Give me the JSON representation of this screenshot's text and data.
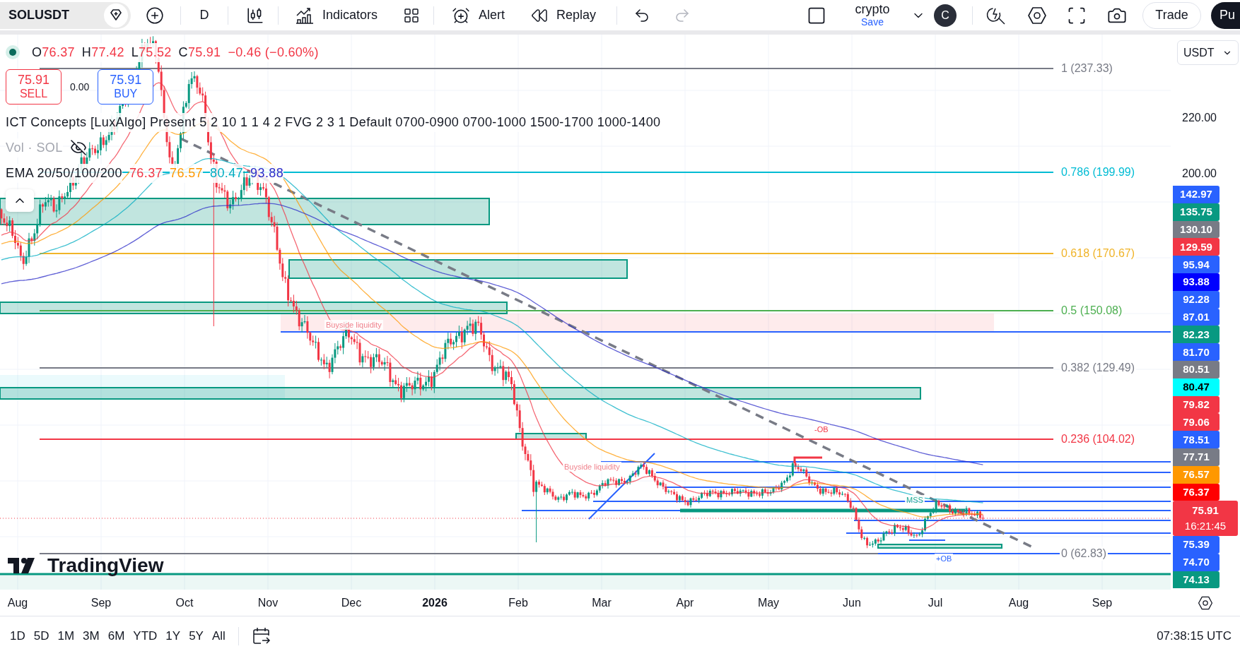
{
  "toolbar": {
    "symbol": "SOLUSDT",
    "interval": "D",
    "buttons": [
      {
        "kind": "indicators",
        "label": "Indicators"
      },
      {
        "kind": "alert",
        "label": "Alert"
      },
      {
        "kind": "replay",
        "label": "Replay"
      }
    ],
    "undo": {
      "disabled": false
    },
    "redo": {
      "disabled": true
    },
    "layout": {
      "name": "crypto",
      "status": "Save"
    },
    "avatar": "C",
    "trade_button": "Trade",
    "publish_button": "Pu"
  },
  "legend": {
    "ohlc": [
      {
        "key": "O",
        "value": "76.37"
      },
      {
        "key": "H",
        "value": "77.42"
      },
      {
        "key": "L",
        "value": "75.52"
      },
      {
        "key": "C",
        "value": "75.91"
      }
    ],
    "change": "−0.46 (−0.60%)"
  },
  "order_buttons": [
    {
      "kind": "sell",
      "price": "75.91",
      "label": "SELL"
    },
    {
      "kind": "buy",
      "price": "75.91",
      "label": "BUY"
    }
  ],
  "spread": "0.00",
  "studies": [
    {
      "title": "ICT Concepts [LuxAlgo] Present 5 2 10 1 1 4 2 FVG 2 3 1 Default 0700-0900 0700-1000 1500-1700 1000-1400",
      "hidden": false
    },
    {
      "title": "Vol · SOL",
      "hidden": true
    },
    {
      "title": "EMA 20/50/100/200",
      "hidden": false,
      "values": [
        {
          "value": "76.37",
          "color": "#f23645"
        },
        {
          "value": "76.57",
          "color": "#ff9800"
        },
        {
          "value": "80.47",
          "color": "#00acc1"
        },
        {
          "value": "93.88",
          "color": "#2c2cc8"
        }
      ]
    }
  ],
  "fib_levels": [
    {
      "label": "1 (237.33)",
      "color": "#787b86"
    },
    {
      "label": "0.786 (199.99)",
      "color": "#00bcd4"
    },
    {
      "label": "0.618 (170.67)",
      "color": "#f0b429"
    },
    {
      "label": "0.5 (150.08)",
      "color": "#4caf50"
    },
    {
      "label": "0.382 (129.49)",
      "color": "#787b86"
    },
    {
      "label": "0.236 (104.02)",
      "color": "#f23645"
    },
    {
      "label": "0 (62.83)",
      "color": "#787b86"
    }
  ],
  "chart_labels": [
    {
      "text": "Buyside liquidity",
      "color": "#f0848e"
    },
    {
      "text": "Buyside liquidity",
      "color": "#f0848e"
    },
    {
      "text": "-OB",
      "color": "#f23645"
    },
    {
      "text": "MSS",
      "color": "#22ab94"
    },
    {
      "text": "+OB",
      "color": "#2962ff"
    }
  ],
  "branding": {
    "logo_text": "TradingView"
  },
  "price_scale": {
    "currency": "USDT",
    "ticks": [
      "220.00",
      "200.00"
    ],
    "tags": [
      {
        "kind": "level",
        "value": "142.97",
        "color": "#2962ff"
      },
      {
        "kind": "level",
        "value": "135.75",
        "color": "#089981"
      },
      {
        "kind": "level",
        "value": "130.10",
        "color": "#787b86"
      },
      {
        "kind": "level",
        "value": "129.59",
        "color": "#f23645"
      },
      {
        "kind": "level",
        "value": "95.94",
        "color": "#2962ff"
      },
      {
        "kind": "level",
        "value": "93.88",
        "color": "#0000ff"
      },
      {
        "kind": "level",
        "value": "92.28",
        "color": "#2962ff"
      },
      {
        "kind": "level",
        "value": "87.01",
        "color": "#2962ff"
      },
      {
        "kind": "level",
        "value": "82.23",
        "color": "#089981"
      },
      {
        "kind": "level",
        "value": "81.70",
        "color": "#2962ff"
      },
      {
        "kind": "level",
        "value": "80.51",
        "color": "#787b86"
      },
      {
        "kind": "level",
        "value": "80.47",
        "color": "#00ffff"
      },
      {
        "kind": "level",
        "value": "79.82",
        "color": "#f23645"
      },
      {
        "kind": "level",
        "value": "79.06",
        "color": "#f23645"
      },
      {
        "kind": "level",
        "value": "78.51",
        "color": "#2962ff"
      },
      {
        "kind": "level",
        "value": "77.71",
        "color": "#787b86"
      },
      {
        "kind": "level",
        "value": "76.57",
        "color": "#ff9800"
      },
      {
        "kind": "level",
        "value": "76.37",
        "color": "#ff0000"
      },
      {
        "kind": "last_price",
        "value": "75.91",
        "countdown": "16:21:45",
        "color": "#f23645"
      },
      {
        "kind": "level",
        "value": "75.39",
        "color": "#2962ff"
      },
      {
        "kind": "level",
        "value": "74.70",
        "color": "#2962ff"
      },
      {
        "kind": "level",
        "value": "74.13",
        "color": "#089981"
      }
    ]
  },
  "time_axis": [
    {
      "kind": "month",
      "text": "Aug"
    },
    {
      "kind": "month",
      "text": "Sep"
    },
    {
      "kind": "month",
      "text": "Oct"
    },
    {
      "kind": "month",
      "text": "Nov"
    },
    {
      "kind": "month",
      "text": "Dec"
    },
    {
      "kind": "year",
      "text": "2026"
    },
    {
      "kind": "month",
      "text": "Feb"
    },
    {
      "kind": "month",
      "text": "Mar"
    },
    {
      "kind": "month",
      "text": "Apr"
    },
    {
      "kind": "month",
      "text": "May"
    },
    {
      "kind": "month",
      "text": "Jun"
    },
    {
      "kind": "month",
      "text": "Jul"
    },
    {
      "kind": "month",
      "text": "Aug"
    },
    {
      "kind": "month",
      "text": "Sep"
    }
  ],
  "range_bar": [
    {
      "label": "1D",
      "selected": false
    },
    {
      "label": "5D",
      "selected": false
    },
    {
      "label": "1M",
      "selected": false
    },
    {
      "label": "3M",
      "selected": false
    },
    {
      "label": "6M",
      "selected": false
    },
    {
      "label": "YTD",
      "selected": false
    },
    {
      "label": "1Y",
      "selected": false
    },
    {
      "label": "5Y",
      "selected": false
    },
    {
      "label": "All",
      "selected": false
    }
  ],
  "clock": "07:38:15 UTC"
}
